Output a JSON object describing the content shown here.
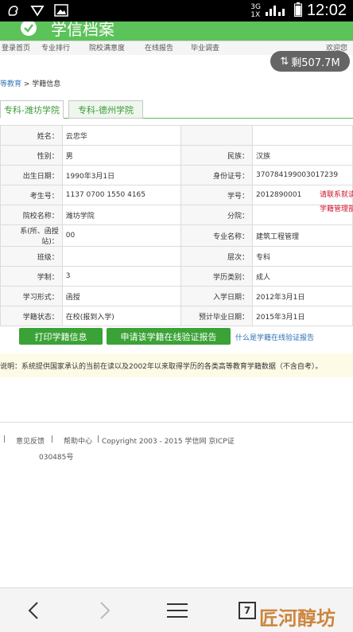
{
  "status_bar": {
    "network": "3G",
    "network2": "1X",
    "time": "12:02"
  },
  "header": {
    "site_title": "学信档案",
    "nav_items": [
      "登录首页",
      "专业排行",
      "院校满意度",
      "在线报告",
      "毕业调查"
    ],
    "nav_right": "欢迎您"
  },
  "traffic_badge": {
    "label": "剩507.7M"
  },
  "breadcrumb": {
    "parent": "等教育",
    "separator": " > ",
    "current": "学籍信息"
  },
  "tabs": [
    {
      "label": "专科-潍坊学院"
    },
    {
      "label": "专科-德州学院"
    }
  ],
  "table": {
    "rows": [
      {
        "l1": "姓名：",
        "v1": "云忠华",
        "l2": "",
        "v2": ""
      },
      {
        "l1": "性别：",
        "v1": "男",
        "l2": "民族：",
        "v2": "汉族"
      },
      {
        "l1": "出生日期：",
        "v1": "1990年3月1日",
        "l2": "身份证号：",
        "v2": "370784199003017239"
      },
      {
        "l1": "考生号：",
        "v1": "1137 0700 1550 4165",
        "l2": "学号：",
        "v2": "2012890001"
      },
      {
        "l1": "院校名称：",
        "v1": "潍坊学院",
        "l2": "分院：",
        "v2": ""
      },
      {
        "l1": "系(所、函授站)：",
        "v1": "00",
        "l2": "专业名称：",
        "v2": "建筑工程管理"
      },
      {
        "l1": "班级：",
        "v1": "",
        "l2": "层次：",
        "v2": "专科"
      },
      {
        "l1": "学制：",
        "v1": "3",
        "l2": "学历类别：",
        "v2": "成人"
      },
      {
        "l1": "学习形式：",
        "v1": "函授",
        "l2": "入学日期：",
        "v2": "2012年3月1日"
      },
      {
        "l1": "学籍状态：",
        "v1": "在校(报到入学)",
        "l2": "预计毕业日期：",
        "v2": "2015年3月1日"
      }
    ],
    "side_note_1": "请联系就读",
    "side_note_2": "学籍管理部"
  },
  "actions": {
    "print_button": "打印学籍信息",
    "apply_button": "申请该学籍在线验证报告",
    "help_link": "什么是学籍在线验证报告"
  },
  "notice": "说明：系统提供国家承认的当前在读以及2002年以来取得学历的各类高等教育学籍数据（不含自考）。",
  "footer": {
    "sep": "|",
    "feedback": "意见反馈",
    "help": "帮助中心",
    "copyright": "Copyright 2003 - 2015  学信网  京ICP证",
    "icp_tail": "030485号"
  },
  "bottom_bar": {
    "tab_count": "7",
    "watermark": "匠河醇坊"
  }
}
